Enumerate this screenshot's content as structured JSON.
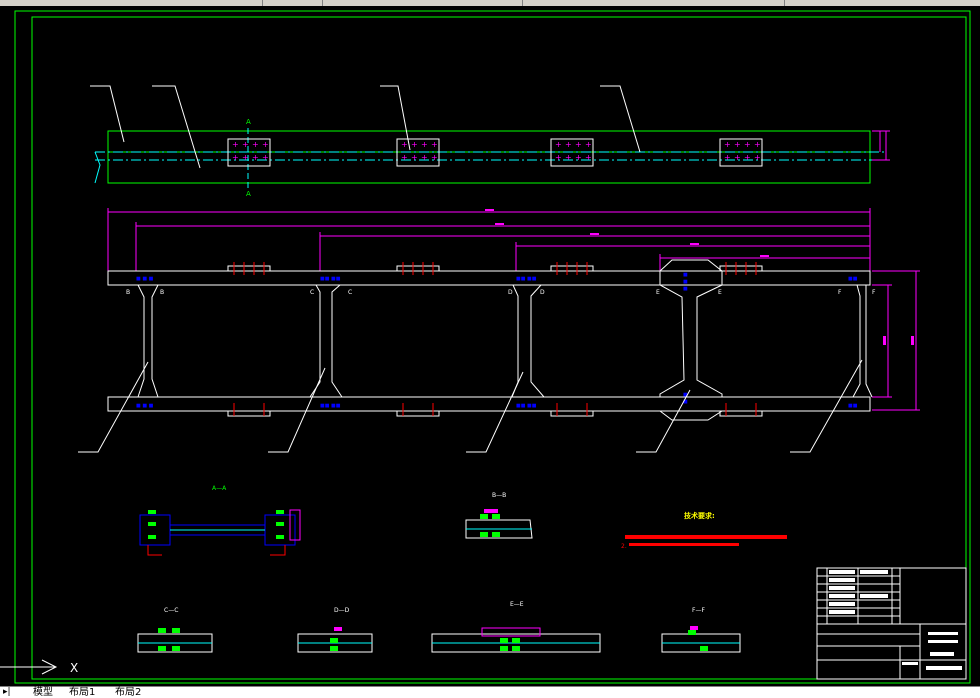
{
  "section_labels": {
    "aa": "A—A",
    "bb": "B—B",
    "cc": "C—C",
    "dd": "D—D",
    "ee": "E—E",
    "ff": "F—F"
  },
  "cut_marks": {
    "a_top": "A",
    "a_bottom": "A",
    "b_left": "B",
    "b_right": "B",
    "c_left": "C",
    "c_right": "C",
    "d_left": "D",
    "d_right": "D",
    "e_left": "E",
    "e_right": "E",
    "f_left": "F",
    "f_right": "F"
  },
  "tech_title": "技术要求:",
  "tech_item_2": "2.",
  "tabs": [
    "模型",
    "布局1",
    "布局2"
  ],
  "ucs_label": "X",
  "colors": {
    "background": "#000000",
    "frame": "#00ff00",
    "outline": "#ffffff",
    "dimension": "#ff00ff",
    "centerline": "#00ffff",
    "bolt": "#0000ff",
    "marker": "#ff0000",
    "tech_title": "#ffff00"
  }
}
